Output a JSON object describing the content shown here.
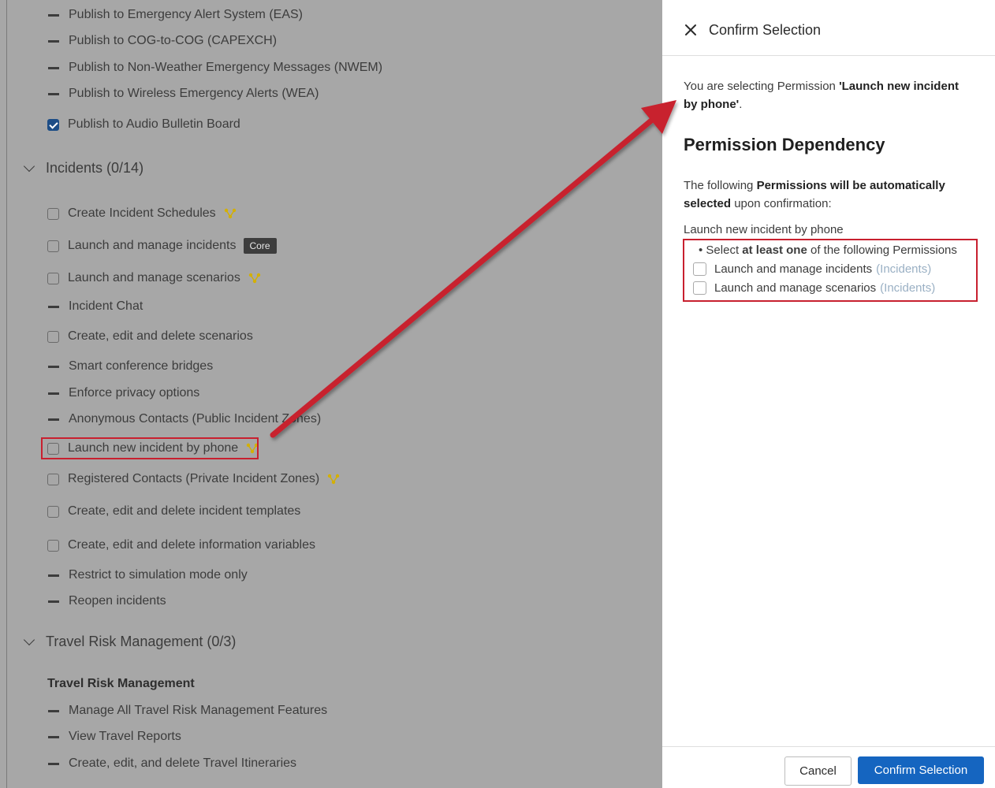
{
  "permissions_list": {
    "top_items": [
      {
        "label": "Publish to Emergency Alert System (EAS)",
        "state": "dash"
      },
      {
        "label": "Publish to COG-to-COG (CAPEXCH)",
        "state": "dash"
      },
      {
        "label": "Publish to Non-Weather Emergency Messages (NWEM)",
        "state": "dash"
      },
      {
        "label": "Publish to Wireless Emergency Alerts (WEA)",
        "state": "dash"
      },
      {
        "label": "Publish to Audio Bulletin Board",
        "state": "checked"
      }
    ],
    "incidents_group": {
      "title": "Incidents (0/14)",
      "items": [
        {
          "label": "Create Incident Schedules",
          "state": "unchecked",
          "dependency_icon": true
        },
        {
          "label": "Launch and manage incidents",
          "state": "unchecked",
          "badge": "Core"
        },
        {
          "label": "Launch and manage scenarios",
          "state": "unchecked",
          "dependency_icon": true
        },
        {
          "label": "Incident Chat",
          "state": "dash"
        },
        {
          "label": "Create, edit and delete scenarios",
          "state": "unchecked"
        },
        {
          "label": "Smart conference bridges",
          "state": "dash"
        },
        {
          "label": "Enforce privacy options",
          "state": "dash"
        },
        {
          "label": "Anonymous Contacts (Public Incident Zones)",
          "state": "dash"
        },
        {
          "label": "Launch new incident by phone",
          "state": "unchecked",
          "dependency_icon": true,
          "highlighted": true
        },
        {
          "label": "Registered Contacts (Private Incident Zones)",
          "state": "unchecked",
          "dependency_icon": true
        },
        {
          "label": "Create, edit and delete incident templates",
          "state": "unchecked"
        },
        {
          "label": "Create, edit and delete information variables",
          "state": "unchecked"
        },
        {
          "label": "Restrict to simulation mode only",
          "state": "dash"
        },
        {
          "label": "Reopen incidents",
          "state": "dash"
        }
      ]
    },
    "travel_group": {
      "title": "Travel Risk Management (0/3)",
      "subheading": "Travel Risk Management",
      "items": [
        {
          "label": "Manage All Travel Risk Management Features",
          "state": "dash"
        },
        {
          "label": "View Travel Reports",
          "state": "dash"
        },
        {
          "label": "Create, edit, and delete Travel Itineraries",
          "state": "dash"
        }
      ]
    }
  },
  "panel": {
    "title": "Confirm Selection",
    "intro_prefix": "You are selecting Permission ",
    "intro_permission": "'Launch new incident by phone'",
    "intro_suffix": ".",
    "dependency_title": "Permission Dependency",
    "following_prefix": "The following ",
    "following_bold": "Permissions will be automatically selected",
    "following_suffix": " upon confirmation:",
    "permission_name": "Launch new incident by phone",
    "rule_prefix": "• Select ",
    "rule_bold": "at least one",
    "rule_suffix": " of the following Permissions",
    "options": [
      {
        "label": "Launch and manage incidents",
        "group": "(Incidents)"
      },
      {
        "label": "Launch and manage scenarios",
        "group": "(Incidents)"
      }
    ],
    "cancel_label": "Cancel",
    "confirm_label": "Confirm Selection"
  },
  "colors": {
    "overlay_gray": "#a7a7a7",
    "highlight_red": "#c8202f",
    "primary_blue": "#1565c0",
    "dependency_icon": "#d4b000"
  }
}
